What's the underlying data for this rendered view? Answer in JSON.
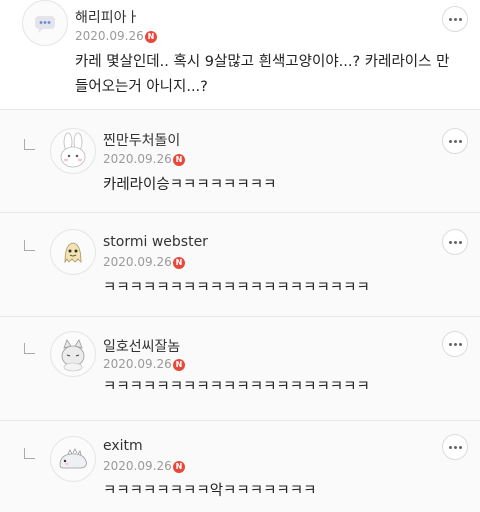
{
  "comments": [
    {
      "author": "해리피아ㅏ",
      "date": "2020.09.26",
      "badge": "N",
      "text": "카레 몇살인데.. 혹시 9살많고 흰색고양이야...? 카레라이스 만들어오는거 아니지...?",
      "avatar": "chat-bubble-avatar"
    },
    {
      "author": "찐만두처돌이",
      "date": "2020.09.26",
      "badge": "N",
      "text": "카레라이승ㅋㅋㅋㅋㅋㅋㅋㅋ",
      "avatar": "bunny-avatar"
    },
    {
      "author": "stormi webster",
      "date": "2020.09.26",
      "badge": "N",
      "text": "ㅋㅋㅋㅋㅋㅋㅋㅋㅋㅋㅋㅋㅋㅋㅋㅋㅋㅋㅋㅋ",
      "avatar": "ghost-avatar"
    },
    {
      "author": "일호선씨잘놈",
      "date": "2020.09.26",
      "badge": "N",
      "text": "ㅋㅋㅋㅋㅋㅋㅋㅋㅋㅋㅋㅋㅋㅋㅋㅋㅋㅋㅋㅋ",
      "avatar": "cat-avatar"
    },
    {
      "author": "exitm",
      "date": "2020.09.26",
      "badge": "N",
      "text": "ㅋㅋㅋㅋㅋㅋㅋㅋ악ㅋㅋㅋㅋㅋㅋㅋ",
      "avatar": "dino-avatar"
    }
  ],
  "colors": {
    "badge": "#e8483c",
    "divider": "#e8e8e8",
    "date": "#9a9a9a"
  }
}
